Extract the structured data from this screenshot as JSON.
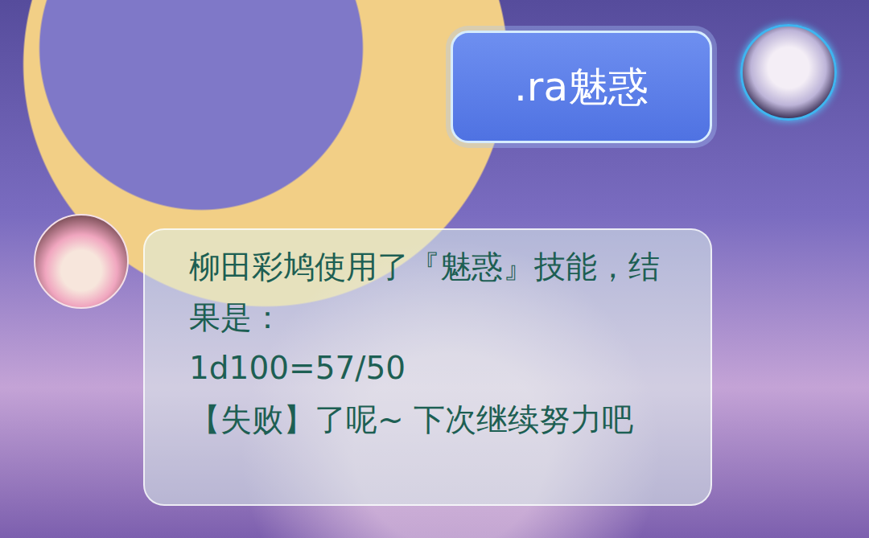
{
  "messages": [
    {
      "kind": "user",
      "lines": [
        ".ra魅惑"
      ]
    },
    {
      "kind": "bot",
      "lines": [
        "柳田彩鸠使用了『魅惑』技能，结果是：",
        "1d100=57/50",
        "【失败】了呢~ 下次继续努力吧"
      ]
    }
  ]
}
